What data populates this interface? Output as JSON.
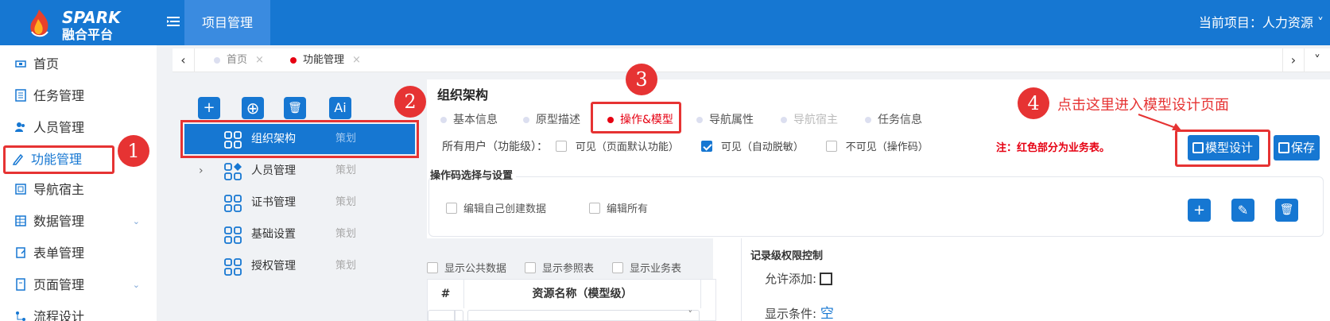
{
  "app": {
    "logo_text": "SPARK",
    "logo_sub": "融合平台",
    "top_tab": "项目管理",
    "current_project": "当前项目：人力资源 ˅"
  },
  "sidebar": {
    "items": [
      {
        "label": "首页",
        "icon": "home-icon"
      },
      {
        "label": "任务管理",
        "icon": "task-icon"
      },
      {
        "label": "人员管理",
        "icon": "users-icon"
      },
      {
        "label": "功能管理",
        "icon": "function-icon",
        "active": true
      },
      {
        "label": "导航宿主",
        "icon": "nav-host-icon"
      },
      {
        "label": "数据管理",
        "icon": "table-icon",
        "expandable": true
      },
      {
        "label": "表单管理",
        "icon": "form-icon"
      },
      {
        "label": "页面管理",
        "icon": "page-icon",
        "expandable": true
      },
      {
        "label": "流程设计",
        "icon": "flow-icon"
      }
    ]
  },
  "tabs": {
    "prev": "‹",
    "next": "›",
    "more": "˅",
    "items": [
      {
        "label": "首页",
        "close": "×"
      },
      {
        "label": "功能管理",
        "close": "×",
        "active": true
      }
    ]
  },
  "toolbar": {
    "add": "+",
    "add_circle": "⊕",
    "delete": "🗑",
    "ai": "Ai"
  },
  "tree": {
    "tag": "策划",
    "expander": "›",
    "rows": [
      {
        "label": "组织架构",
        "selected": true
      },
      {
        "label": "人员管理",
        "expandable": true
      },
      {
        "label": "证书管理"
      },
      {
        "label": "基础设置"
      },
      {
        "label": "授权管理"
      }
    ]
  },
  "main": {
    "title": "组织架构",
    "subtabs": [
      "基本信息",
      "原型描述",
      "操作&模型",
      "导航属性",
      "导航宿主",
      "任务信息"
    ],
    "perm_label": "所有用户（功能级）：",
    "perm_opts": [
      "可见（页面默认功能）",
      "可见（自动脱敏）",
      "不可见（操作码）"
    ],
    "note": "注：红色部分为业务表。",
    "model_button": "模型设计",
    "save_button": "保存",
    "section_title": "操作码选择与设置",
    "section_opts": [
      "编辑自己创建数据",
      "编辑所有"
    ],
    "icon_add": "+",
    "icon_edit": "✎",
    "icon_delete": "🗑",
    "show_opts": [
      "显示公共数据",
      "显示参照表",
      "显示业务表"
    ],
    "table_headers": [
      "#",
      "资源名称（模型级）"
    ],
    "cell_arrow": "˅",
    "record_title": "记录级权限控制",
    "allow_add": "允许添加:",
    "show_cond": "显示条件:",
    "show_cond_value": "空"
  },
  "annotations": {
    "badges": [
      "1",
      "2",
      "3",
      "4"
    ],
    "hint": "点击这里进入模型设计页面"
  },
  "colors": {
    "primary": "#1677d2",
    "annotation": "#e63333",
    "active_dot": "#e60012"
  }
}
